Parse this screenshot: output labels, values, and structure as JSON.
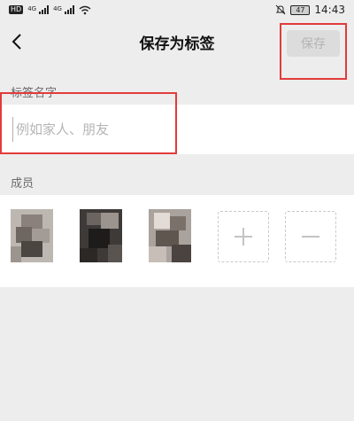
{
  "status_bar": {
    "hd_badge": "HD",
    "net_label_1": "4G",
    "net_label_2": "4G",
    "battery": "47",
    "time": "14:43"
  },
  "header": {
    "title": "保存为标签",
    "save_label": "保存",
    "back_icon": "chevron-left-icon"
  },
  "name_section": {
    "label": "标签名字",
    "placeholder": "例如家人、朋友",
    "value": ""
  },
  "members_section": {
    "label": "成员",
    "add_icon": "plus-icon",
    "remove_icon": "minus-icon"
  },
  "colors": {
    "background": "#ededed",
    "highlight": "#e23b3b",
    "save_disabled_bg": "#dcdcdc",
    "save_disabled_text": "#b4b4b4"
  }
}
